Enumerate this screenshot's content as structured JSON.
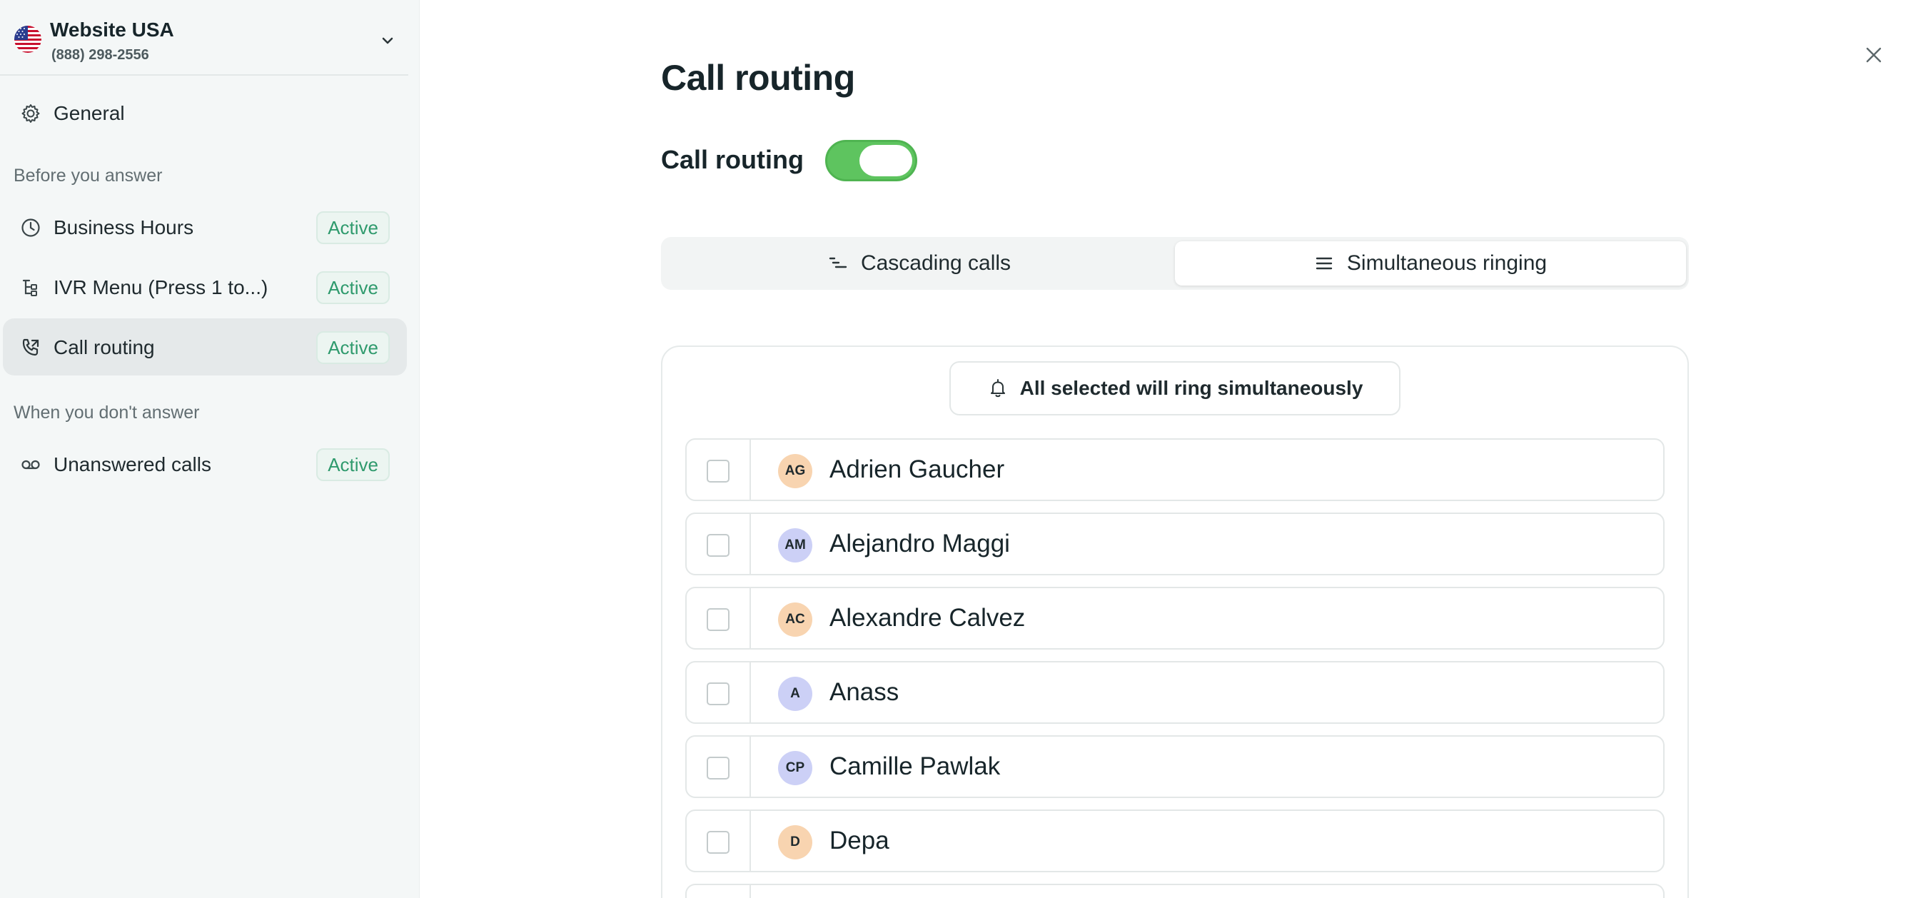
{
  "account": {
    "name": "Website USA",
    "phone": "(888) 298-2556"
  },
  "sidebar": {
    "general": {
      "label": "General",
      "icon": "gear-icon"
    },
    "section_before": "Before you answer",
    "section_after": "When you don't answer",
    "items": [
      {
        "label": "Business Hours",
        "badge": "Active",
        "icon": "clock-icon"
      },
      {
        "label": "IVR Menu (Press 1 to...)",
        "badge": "Active",
        "icon": "ivr-tree-icon"
      },
      {
        "label": "Call routing",
        "badge": "Active",
        "icon": "phone-forward-icon",
        "selected": true
      },
      {
        "label": "Unanswered calls",
        "badge": "Active",
        "icon": "voicemail-icon"
      }
    ]
  },
  "main": {
    "title": "Call routing",
    "toggle_label": "Call routing",
    "toggle_on": true,
    "tabs": [
      {
        "label": "Cascading calls",
        "icon": "cascade-icon",
        "selected": false
      },
      {
        "label": "Simultaneous ringing",
        "icon": "lines-icon",
        "selected": true
      }
    ],
    "notice": "All selected will ring simultaneously",
    "members": [
      {
        "initials": "AG",
        "name": "Adrien Gaucher",
        "color": "#f8d4b0"
      },
      {
        "initials": "AM",
        "name": "Alejandro Maggi",
        "color": "#ccd0f6"
      },
      {
        "initials": "AC",
        "name": "Alexandre Calvez",
        "color": "#f8d4b0"
      },
      {
        "initials": "A",
        "name": "Anass",
        "color": "#ccd0f6"
      },
      {
        "initials": "CP",
        "name": "Camille Pawlak",
        "color": "#ccd0f6"
      },
      {
        "initials": "D",
        "name": "Depa",
        "color": "#f8d4b0"
      }
    ]
  },
  "colors": {
    "accent_green": "#5ec45f",
    "badge_text": "#2f9a6d",
    "sidebar_bg": "#f4f7f7"
  }
}
